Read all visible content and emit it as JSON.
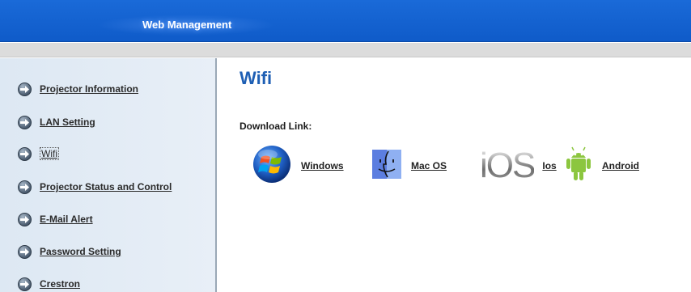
{
  "header": {
    "title": "Web Management"
  },
  "sidebar": {
    "items": [
      {
        "label": "Projector Information",
        "current": false
      },
      {
        "label": "LAN Setting",
        "current": false
      },
      {
        "label": "Wifi",
        "current": true
      },
      {
        "label": "Projector Status and Control",
        "current": false
      },
      {
        "label": "E-Mail Alert",
        "current": false
      },
      {
        "label": "Password Setting",
        "current": false
      },
      {
        "label": "Crestron",
        "current": false
      }
    ]
  },
  "main": {
    "title": "Wifi",
    "download_label": "Download Link:",
    "downloads": [
      {
        "label": "Windows",
        "icon": "windows-logo-icon"
      },
      {
        "label": "Mac OS",
        "icon": "mac-finder-icon"
      },
      {
        "label": "Ios",
        "icon": "ios-logo-icon"
      },
      {
        "label": "Android",
        "icon": "android-robot-icon"
      }
    ]
  },
  "colors": {
    "header_blue": "#1565d0",
    "title_blue": "#1e5fb4",
    "sidebar_bg": "#dde8f3",
    "android_green": "#8cc63f"
  }
}
